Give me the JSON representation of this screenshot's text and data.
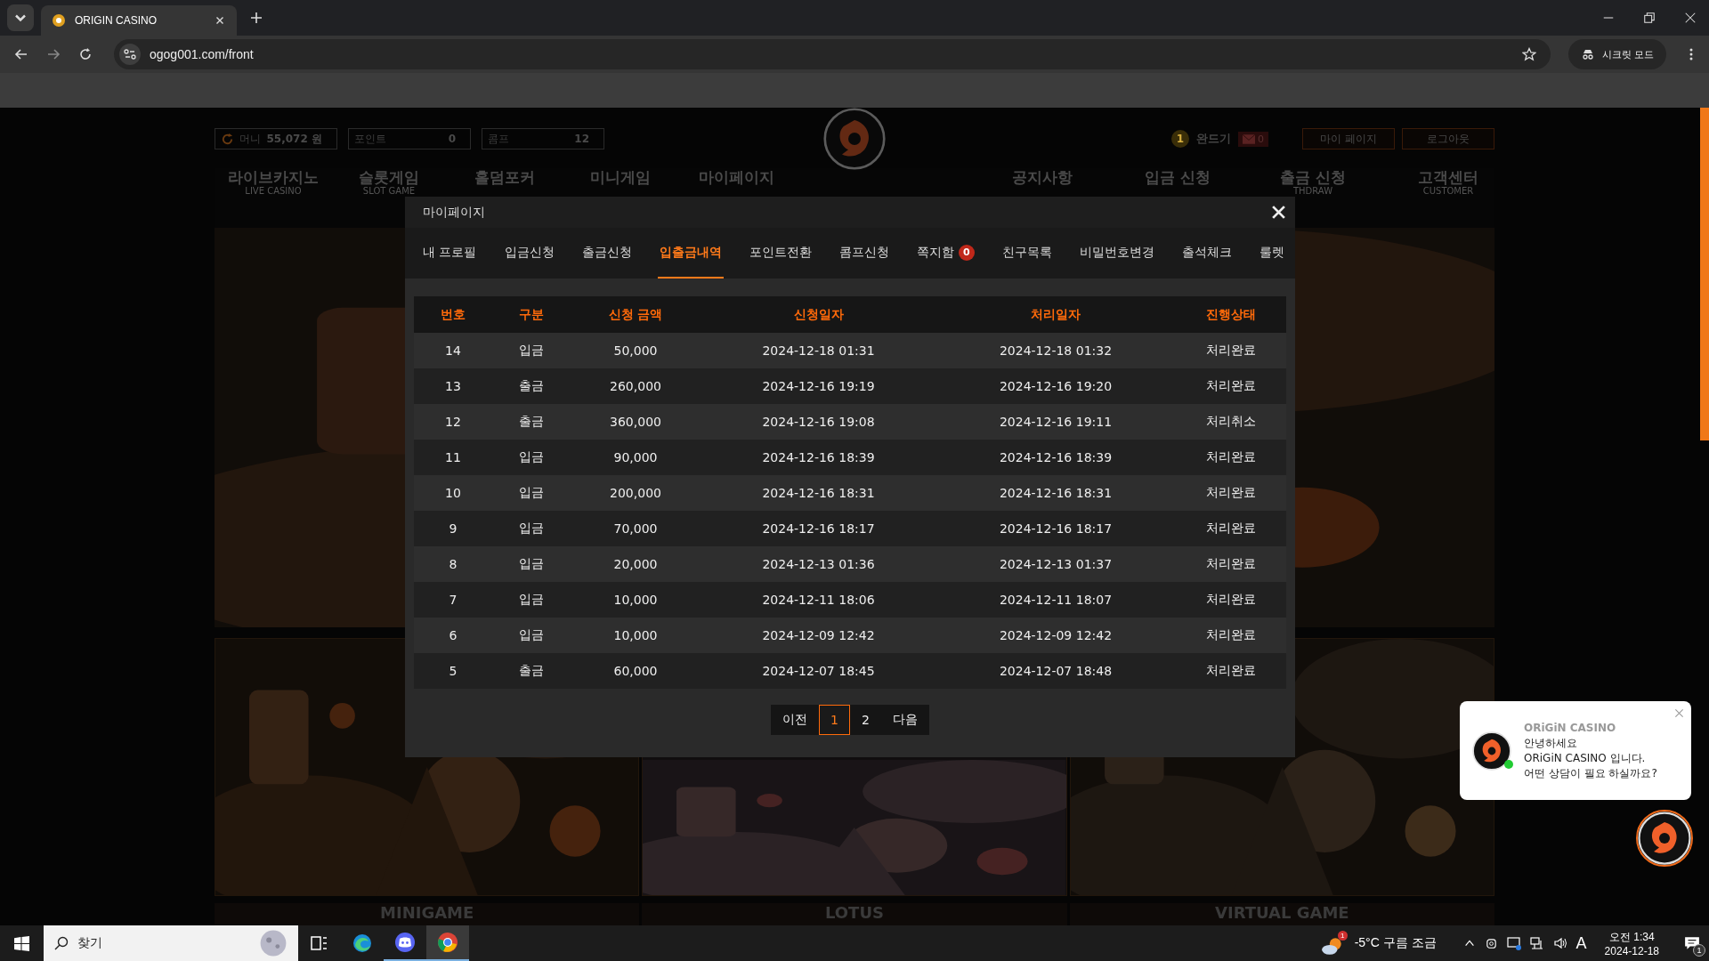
{
  "browser": {
    "tabs": [
      {
        "title": "ORIGIN CASINO",
        "selected": true
      }
    ],
    "url": "ogog001.com/front",
    "incognito_label": "시크릿 모드"
  },
  "site": {
    "wallet": [
      {
        "label": "머니",
        "value": "55,072 원"
      },
      {
        "label": "포인트",
        "value": "0"
      },
      {
        "label": "콤프",
        "value": "12"
      }
    ],
    "user": {
      "level": "1",
      "name": "완드기",
      "messages": "0"
    },
    "header_buttons": [
      "마이 페이지",
      "로그아웃"
    ],
    "nav_left": [
      {
        "label": "라이브카지노",
        "sublabel": "LIVE CASINO"
      },
      {
        "label": "슬롯게임",
        "sublabel": "SLOT GAME"
      },
      {
        "label": "홀덤포커"
      },
      {
        "label": "미니게임"
      },
      {
        "label": "마이페이지"
      }
    ],
    "nav_right": [
      {
        "label": "공지사항"
      },
      {
        "label": "입금 신청"
      },
      {
        "label": "출금 신청",
        "sublabel": "THDRAW"
      },
      {
        "label": "고객센터",
        "sublabel": "CUSTOMER"
      }
    ],
    "bottom_cards": [
      "MINIGAME",
      "LOTUS",
      "VIRTUAL GAME"
    ]
  },
  "modal": {
    "title": "마이페이지",
    "tabs": [
      {
        "label": "내 프로필",
        "selected": false
      },
      {
        "label": "입금신청",
        "selected": false
      },
      {
        "label": "출금신청",
        "selected": false
      },
      {
        "label": "입출금내역",
        "selected": true
      },
      {
        "label": "포인트전환",
        "selected": false
      },
      {
        "label": "콤프신청",
        "selected": false
      },
      {
        "label": "쪽지함",
        "selected": false,
        "badge": "0"
      },
      {
        "label": "친구목록",
        "selected": false
      },
      {
        "label": "비밀번호변경",
        "selected": false
      },
      {
        "label": "출석체크",
        "selected": false
      },
      {
        "label": "룰렛",
        "selected": false
      }
    ],
    "table": {
      "columns": [
        "번호",
        "구분",
        "신청 금액",
        "신청일자",
        "처리일자",
        "진행상태"
      ],
      "rows": [
        [
          "14",
          "입금",
          "50,000",
          "2024-12-18 01:31",
          "2024-12-18 01:32",
          "처리완료"
        ],
        [
          "13",
          "출금",
          "260,000",
          "2024-12-16 19:19",
          "2024-12-16 19:20",
          "처리완료"
        ],
        [
          "12",
          "출금",
          "360,000",
          "2024-12-16 19:08",
          "2024-12-16 19:11",
          "처리취소"
        ],
        [
          "11",
          "입금",
          "90,000",
          "2024-12-16 18:39",
          "2024-12-16 18:39",
          "처리완료"
        ],
        [
          "10",
          "입금",
          "200,000",
          "2024-12-16 18:31",
          "2024-12-16 18:31",
          "처리완료"
        ],
        [
          "9",
          "입금",
          "70,000",
          "2024-12-16 18:17",
          "2024-12-16 18:17",
          "처리완료"
        ],
        [
          "8",
          "입금",
          "20,000",
          "2024-12-13 01:36",
          "2024-12-13 01:37",
          "처리완료"
        ],
        [
          "7",
          "입금",
          "10,000",
          "2024-12-11 18:06",
          "2024-12-11 18:07",
          "처리완료"
        ],
        [
          "6",
          "입금",
          "10,000",
          "2024-12-09 12:42",
          "2024-12-09 12:42",
          "처리완료"
        ],
        [
          "5",
          "출금",
          "60,000",
          "2024-12-07 18:45",
          "2024-12-07 18:48",
          "처리완료"
        ]
      ]
    },
    "pagination": [
      {
        "label": "이전",
        "selected": false
      },
      {
        "label": "1",
        "selected": true
      },
      {
        "label": "2",
        "selected": false
      },
      {
        "label": "다음",
        "selected": false
      }
    ]
  },
  "chat": {
    "name": "ORiGiN CASINO",
    "online": true,
    "lines": [
      "안녕하세요",
      "ORiGiN CASINO 입니다.",
      "어떤 상담이 필요 하실까요?"
    ]
  },
  "taskbar": {
    "search_placeholder": "찾기",
    "apps": [
      {
        "kind": "taskview",
        "running": false,
        "selected": false
      },
      {
        "kind": "edge",
        "running": false,
        "selected": false
      },
      {
        "kind": "discord",
        "running": true,
        "selected": false
      },
      {
        "kind": "chrome",
        "running": true,
        "selected": true
      }
    ],
    "weather": {
      "text": "-5°C 구름 조금",
      "badge": "1"
    },
    "ime": "A",
    "time": "오전 1:34",
    "date": "2024-12-18",
    "notifications": "1"
  }
}
